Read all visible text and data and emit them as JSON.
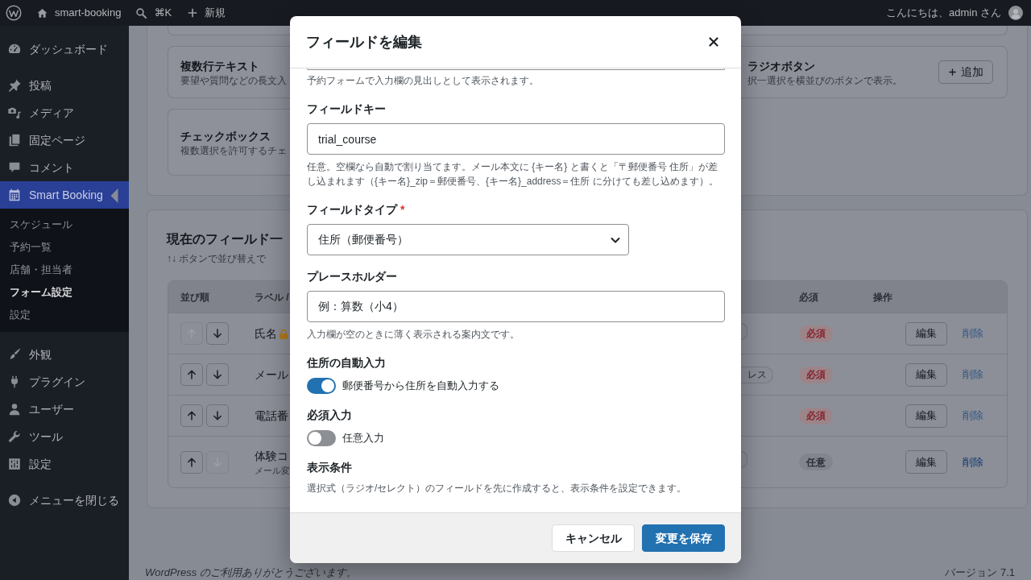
{
  "admin_bar": {
    "site_name": "smart-booking",
    "search_shortcut": "⌘K",
    "new_label": "新規",
    "greeting": "こんにちは、admin さん"
  },
  "sidebar": {
    "groups": [
      {
        "items": [
          {
            "label": "ダッシュボード",
            "selected": false
          }
        ]
      },
      {
        "items": [
          {
            "label": "投稿",
            "selected": false
          },
          {
            "label": "メディア",
            "selected": false
          },
          {
            "label": "固定ページ",
            "selected": false
          },
          {
            "label": "コメント",
            "selected": false
          },
          {
            "label": "Smart Booking",
            "selected": true,
            "children": [
              {
                "label": "スケジュール",
                "selected": false
              },
              {
                "label": "予約一覧",
                "selected": false
              },
              {
                "label": "店舗・担当者",
                "selected": false
              },
              {
                "label": "フォーム設定",
                "selected": true
              },
              {
                "label": "設定",
                "selected": false
              }
            ]
          }
        ]
      },
      {
        "items": [
          {
            "label": "外観",
            "selected": false
          },
          {
            "label": "プラグイン",
            "selected": false
          },
          {
            "label": "ユーザー",
            "selected": false
          },
          {
            "label": "ツール",
            "selected": false
          },
          {
            "label": "設定",
            "selected": false
          }
        ]
      }
    ],
    "collapse_label": "メニューを閉じる"
  },
  "field_types": {
    "left_tiles": [
      {
        "title": "複数行テキスト",
        "description": "要望や質問などの長文入"
      },
      {
        "title": "チェックボックス",
        "description": "複数選択を許可するチェ"
      }
    ],
    "right_tiles": [
      {
        "title": "ラジオボタン",
        "description": "択一選択を横並びのボタンで表示。",
        "button": "追加"
      }
    ]
  },
  "field_list": {
    "title": "現在のフィールド一",
    "hint": "↑↓ ボタンで並び替えで",
    "columns_left": [
      "並び順",
      "ラベル /"
    ],
    "columns_right": [
      "必須",
      "操作"
    ],
    "rows": [
      {
        "label": "氏名",
        "locked": true,
        "up_disabled": true,
        "down_disabled": false,
        "type_tag_edge": true,
        "required": true,
        "required_label": "必須",
        "edit_label": "編集",
        "delete_label": "削除",
        "delete_disabled": true
      },
      {
        "label": "メール",
        "locked": false,
        "up_disabled": false,
        "down_disabled": false,
        "type_tag_edge": false,
        "type_tag": "レス",
        "required": true,
        "required_label": "必須",
        "edit_label": "編集",
        "delete_label": "削除",
        "delete_disabled": true
      },
      {
        "label": "電話番",
        "locked": false,
        "up_disabled": false,
        "down_disabled": false,
        "type_tag_edge": false,
        "required": true,
        "required_label": "必須",
        "edit_label": "編集",
        "delete_label": "削除",
        "delete_disabled": true
      },
      {
        "label": "体験コ",
        "note": "メール変",
        "locked": false,
        "up_disabled": false,
        "down_disabled": true,
        "type_tag_edge": true,
        "required": false,
        "required_label": "任意",
        "edit_label": "編集",
        "delete_label": "削除",
        "delete_disabled": false
      }
    ]
  },
  "footer": {
    "link": "WordPress",
    "thanks": "のご利用ありがとうございます。",
    "version": "バージョン 7.1"
  },
  "modal": {
    "title": "フィールドを編集",
    "intro_help": "予約フォームで入力欄の見出しとして表示されます。",
    "fields": [
      {
        "kind": "text",
        "label": "フィールドキー",
        "value": "trial_course",
        "help": "任意。空欄なら自動で割り当てます。メール本文に {キー名} と書くと「〒郵便番号 住所」が差し込まれます（{キー名}_zip＝郵便番号、{キー名}_address＝住所 に分けても差し込めます）。"
      },
      {
        "kind": "select",
        "label": "フィールドタイプ",
        "required_mark": "*",
        "value": "住所（郵便番号）"
      },
      {
        "kind": "text",
        "label": "プレースホルダー",
        "value": "例：算数（小4）",
        "help": "入力欄が空のときに薄く表示される案内文です。"
      },
      {
        "kind": "toggle",
        "label": "住所の自動入力",
        "on": true,
        "toggle_label": "郵便番号から住所を自動入力する"
      },
      {
        "kind": "toggle",
        "label": "必須入力",
        "on": false,
        "toggle_label": "任意入力"
      },
      {
        "kind": "note",
        "label": "表示条件",
        "help": "選択式（ラジオ/セレクト）のフィールドを先に作成すると、表示条件を設定できます。"
      }
    ],
    "buttons": [
      {
        "label": "キャンセル",
        "kind": "secondary"
      },
      {
        "label": "変更を保存",
        "kind": "primary"
      }
    ]
  }
}
